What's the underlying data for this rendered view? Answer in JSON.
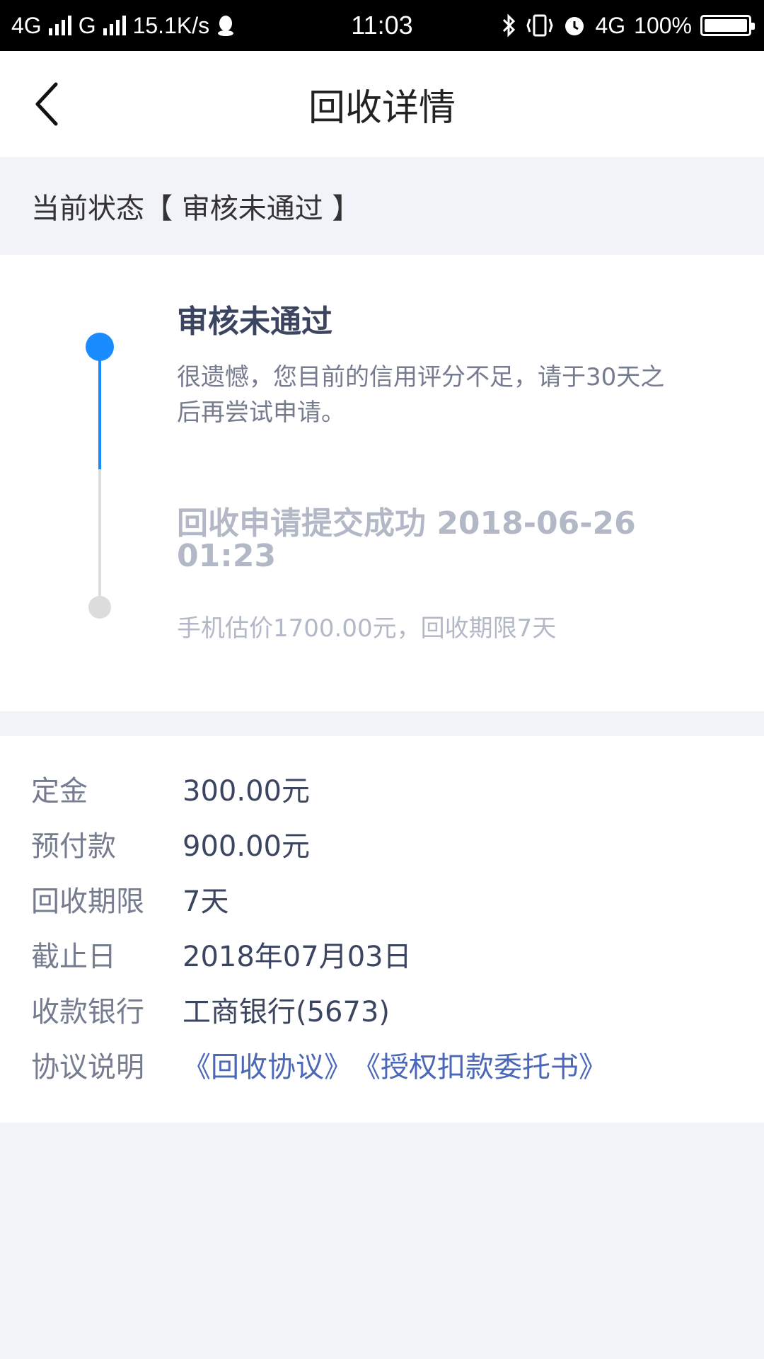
{
  "status_bar": {
    "network1": "4G",
    "network2": "G",
    "speed": "15.1K/s",
    "time": "11:03",
    "network3": "4G",
    "battery": "100%",
    "icons": [
      "signal-icon",
      "qq-icon",
      "bluetooth-icon",
      "vibrate-icon",
      "alarm-icon",
      "battery-icon"
    ]
  },
  "nav": {
    "title": "回收详情",
    "back_icon": "chevron-left-icon"
  },
  "current_status": {
    "text": "当前状态【 审核未通过 】"
  },
  "timeline": [
    {
      "title": "审核未通过",
      "desc": "很遗憾，您目前的信用评分不足，请于30天之后再尝试申请。",
      "active": true
    },
    {
      "title": "回收申请提交成功 2018-06-26 01:23",
      "desc": "手机估价1700.00元，回收期限7天",
      "active": false
    }
  ],
  "details": [
    {
      "label": "定金",
      "value": "300.00元"
    },
    {
      "label": "预付款",
      "value": "900.00元"
    },
    {
      "label": "回收期限",
      "value": "7天"
    },
    {
      "label": "截止日",
      "value": "2018年07月03日"
    },
    {
      "label": "收款银行",
      "value": "工商银行(5673)"
    }
  ],
  "agreement": {
    "label": "协议说明",
    "links": [
      "《回收协议》",
      "《授权扣款委托书》"
    ]
  },
  "colors": {
    "accent": "#1a8cff",
    "link": "#4a67b8",
    "background": "#f1f3f8"
  }
}
